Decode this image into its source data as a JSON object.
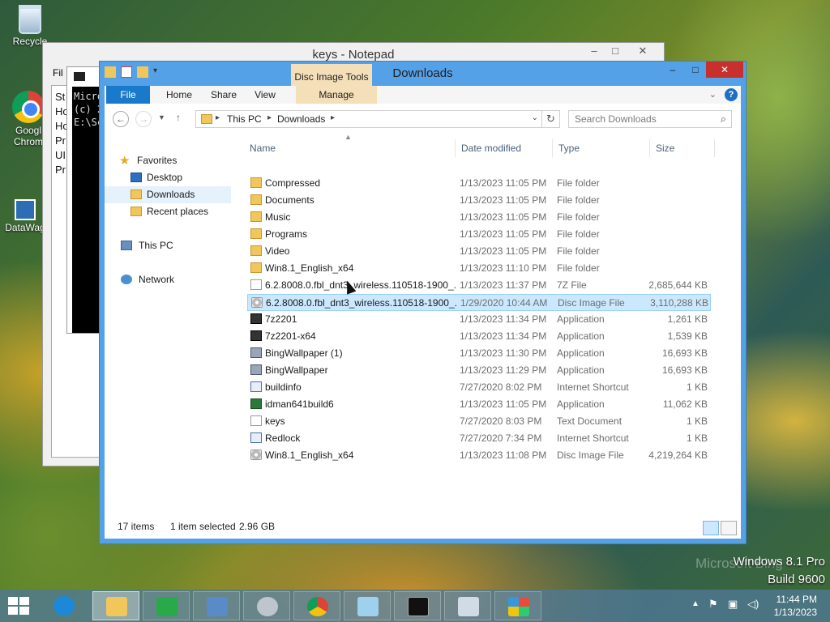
{
  "desktop": {
    "icons": [
      {
        "label": "Recycle",
        "icon": "recycle-bin-icon"
      },
      {
        "label": "Googl Chrom",
        "icon": "chrome-icon"
      },
      {
        "label": "DataWag",
        "icon": "shortcut-icon"
      }
    ]
  },
  "notepad": {
    "title": "keys - Notepad",
    "menu_file": "Fil",
    "lines": [
      "St",
      "Ho",
      "Ho",
      "Pr",
      "UI",
      "Pr"
    ]
  },
  "cmd": {
    "lines": [
      "Micro",
      "(c) 2",
      "",
      "E:\\Sc"
    ]
  },
  "explorer": {
    "title": "Downloads",
    "contextual_tab_group": "Disc Image Tools",
    "ribbon_tabs": [
      "File",
      "Home",
      "Share",
      "View",
      "Manage"
    ],
    "address": {
      "crumbs": [
        "This PC",
        "Downloads"
      ]
    },
    "search_placeholder": "Search Downloads",
    "nav": {
      "favorites": "Favorites",
      "desktop": "Desktop",
      "downloads": "Downloads",
      "recent": "Recent places",
      "this_pc": "This PC",
      "network": "Network"
    },
    "columns": {
      "name": "Name",
      "date": "Date modified",
      "type": "Type",
      "size": "Size"
    },
    "files": [
      {
        "name": "Compressed",
        "date": "1/13/2023 11:05 PM",
        "type": "File folder",
        "size": "",
        "icon": "folder-icon"
      },
      {
        "name": "Documents",
        "date": "1/13/2023 11:05 PM",
        "type": "File folder",
        "size": "",
        "icon": "folder-icon"
      },
      {
        "name": "Music",
        "date": "1/13/2023 11:05 PM",
        "type": "File folder",
        "size": "",
        "icon": "folder-icon"
      },
      {
        "name": "Programs",
        "date": "1/13/2023 11:05 PM",
        "type": "File folder",
        "size": "",
        "icon": "folder-icon"
      },
      {
        "name": "Video",
        "date": "1/13/2023 11:05 PM",
        "type": "File folder",
        "size": "",
        "icon": "folder-icon"
      },
      {
        "name": "Win8.1_English_x64",
        "date": "1/13/2023 11:10 PM",
        "type": "File folder",
        "size": "",
        "icon": "folder-icon"
      },
      {
        "name": "6.2.8008.0.fbl_dnt3_wireless.110518-1900_...",
        "date": "1/13/2023 11:37 PM",
        "type": "7Z File",
        "size": "2,685,644 KB",
        "icon": "archive-icon"
      },
      {
        "name": "6.2.8008.0.fbl_dnt3_wireless.110518-1900_...",
        "date": "1/29/2020 10:44 AM",
        "type": "Disc Image File",
        "size": "3,110,288 KB",
        "icon": "disc-image-icon",
        "selected": true
      },
      {
        "name": "7z2201",
        "date": "1/13/2023 11:34 PM",
        "type": "Application",
        "size": "1,261 KB",
        "icon": "7zip-icon"
      },
      {
        "name": "7z2201-x64",
        "date": "1/13/2023 11:34 PM",
        "type": "Application",
        "size": "1,539 KB",
        "icon": "7zip-icon"
      },
      {
        "name": "BingWallpaper (1)",
        "date": "1/13/2023 11:30 PM",
        "type": "Application",
        "size": "16,693 KB",
        "icon": "application-icon"
      },
      {
        "name": "BingWallpaper",
        "date": "1/13/2023 11:29 PM",
        "type": "Application",
        "size": "16,693 KB",
        "icon": "application-icon"
      },
      {
        "name": "buildinfo",
        "date": "7/27/2020 8:02 PM",
        "type": "Internet Shortcut",
        "size": "1 KB",
        "icon": "internet-shortcut-icon"
      },
      {
        "name": "idman641build6",
        "date": "1/13/2023 11:05 PM",
        "type": "Application",
        "size": "11,062 KB",
        "icon": "idm-icon"
      },
      {
        "name": "keys",
        "date": "7/27/2020 8:03 PM",
        "type": "Text Document",
        "size": "1 KB",
        "icon": "text-document-icon"
      },
      {
        "name": "Redlock",
        "date": "7/27/2020 7:34 PM",
        "type": "Internet Shortcut",
        "size": "1 KB",
        "icon": "internet-shortcut-icon"
      },
      {
        "name": "Win8.1_English_x64",
        "date": "1/13/2023 11:08 PM",
        "type": "Disc Image File",
        "size": "4,219,264 KB",
        "icon": "disc-image-icon"
      }
    ],
    "status": {
      "items": "17 items",
      "selected": "1 item selected",
      "size": "2.96 GB"
    }
  },
  "watermark": {
    "line1": "Windows 8.1 Pro",
    "line2": "Build 9600",
    "ghost": "Microsoft Bing"
  },
  "taskbar": {
    "apps": [
      "file-explorer-icon",
      "store-icon",
      "control-panel-icon",
      "sound-icon",
      "chrome-icon",
      "notepad-icon",
      "command-prompt-icon",
      "performance-icon",
      "windows-media-icon"
    ],
    "time": "11:44 PM",
    "date": "1/13/2023"
  },
  "colors": {
    "accent": "#1979ca",
    "contextual": "#f4dfb8",
    "selection": "#cce8ff",
    "close": "#c7302c"
  }
}
